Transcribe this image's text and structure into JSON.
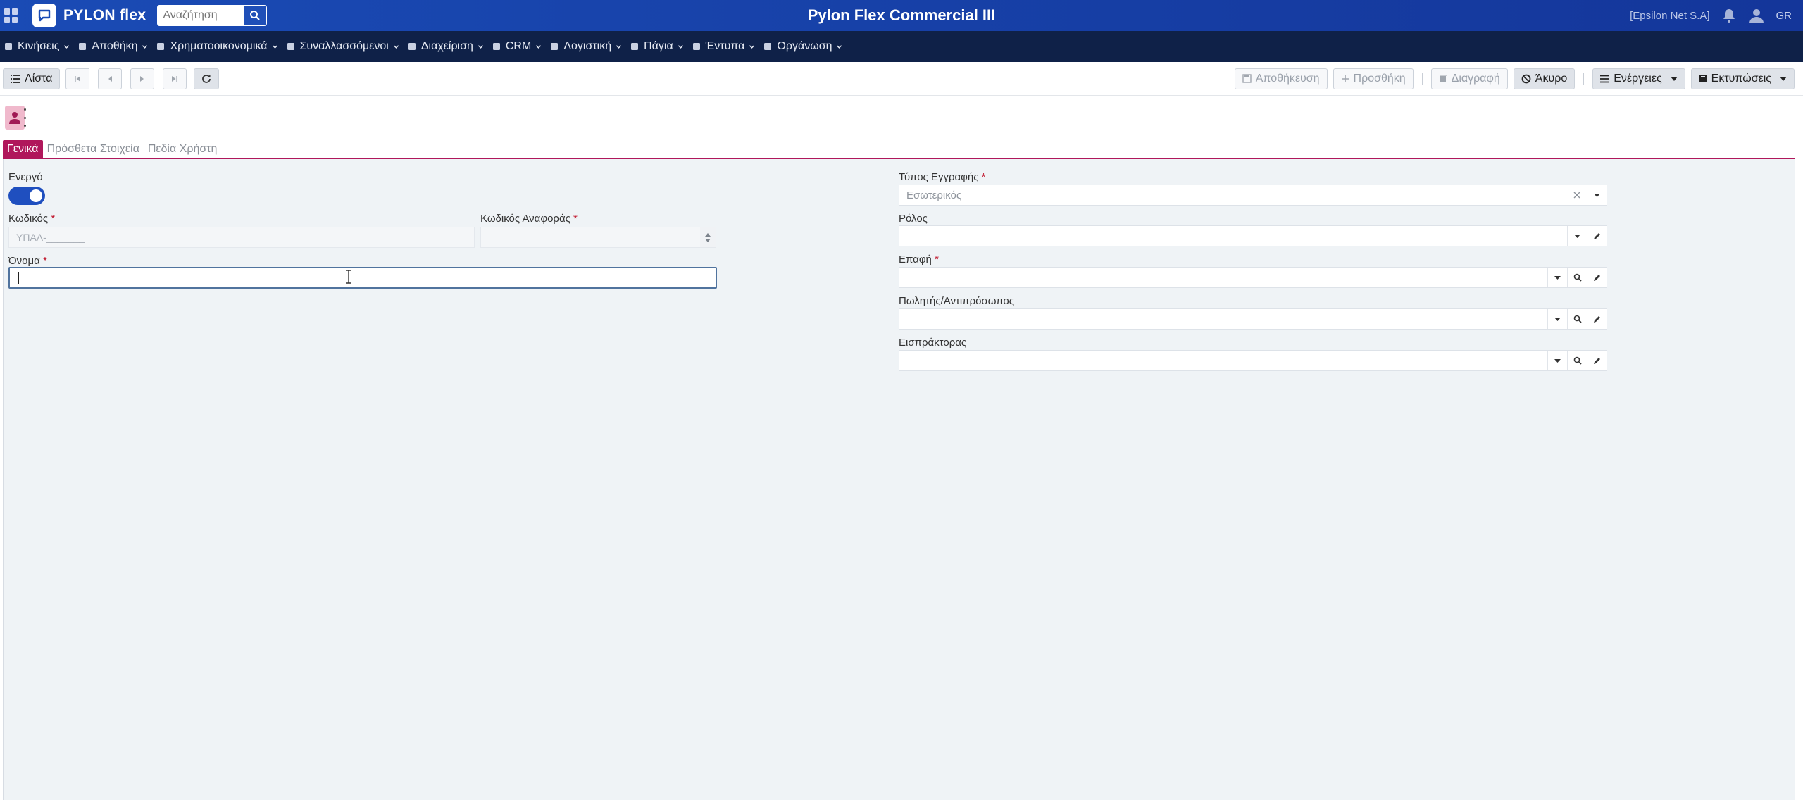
{
  "topbar": {
    "logo_text": "PYLON flex",
    "search_placeholder": "Αναζήτηση",
    "app_title": "Pylon Flex Commercial III",
    "company": "[Epsilon Net S.A]",
    "language": "GR"
  },
  "menu": {
    "items": [
      {
        "label": "Κινήσεις",
        "icon": "doc-icon"
      },
      {
        "label": "Αποθήκη",
        "icon": "warehouse-icon"
      },
      {
        "label": "Χρηματοοικονομικά",
        "icon": "money-icon"
      },
      {
        "label": "Συναλλασσόμενοι",
        "icon": "handshake-icon"
      },
      {
        "label": "Διαχείριση",
        "icon": "book-icon"
      },
      {
        "label": "CRM",
        "icon": "crm-icon"
      },
      {
        "label": "Λογιστική",
        "icon": "scale-icon"
      },
      {
        "label": "Πάγια",
        "icon": "truck-icon"
      },
      {
        "label": "Έντυπα",
        "icon": "form-icon"
      },
      {
        "label": "Οργάνωση",
        "icon": "gear-icon"
      }
    ]
  },
  "toolbar": {
    "list_label": "Λίστα",
    "save_label": "Αποθήκευση",
    "add_label": "Προσθήκη",
    "delete_label": "Διαγραφή",
    "cancel_label": "Άκυρο",
    "actions_label": "Ενέργειες",
    "prints_label": "Εκτυπώσεις"
  },
  "tabs": [
    {
      "label": "Γενικά",
      "active": true
    },
    {
      "label": "Πρόσθετα Στοιχεία",
      "active": false
    },
    {
      "label": "Πεδία Χρήστη",
      "active": false
    }
  ],
  "form": {
    "active_label": "Ενεργό",
    "active_value": true,
    "code_label": "Κωδικός",
    "code_value": "ΥΠΑΛ-_______",
    "ref_code_label": "Κωδικός Αναφοράς",
    "ref_code_value": "",
    "name_label": "Όνομα",
    "name_value": "",
    "record_type_label": "Τύπος Εγγραφής",
    "record_type_value": "Εσωτερικός",
    "role_label": "Ρόλος",
    "role_value": "",
    "contact_label": "Επαφή",
    "contact_value": "",
    "salesman_label": "Πωλητής/Αντιπρόσωπος",
    "salesman_value": "",
    "collector_label": "Εισπράκτορας",
    "collector_value": "",
    "required_mark": "*"
  },
  "colors": {
    "topbar": "#1a4bb5",
    "menubar": "#0f2148",
    "accent": "#b0175b",
    "toggle": "#1f4fbf"
  }
}
